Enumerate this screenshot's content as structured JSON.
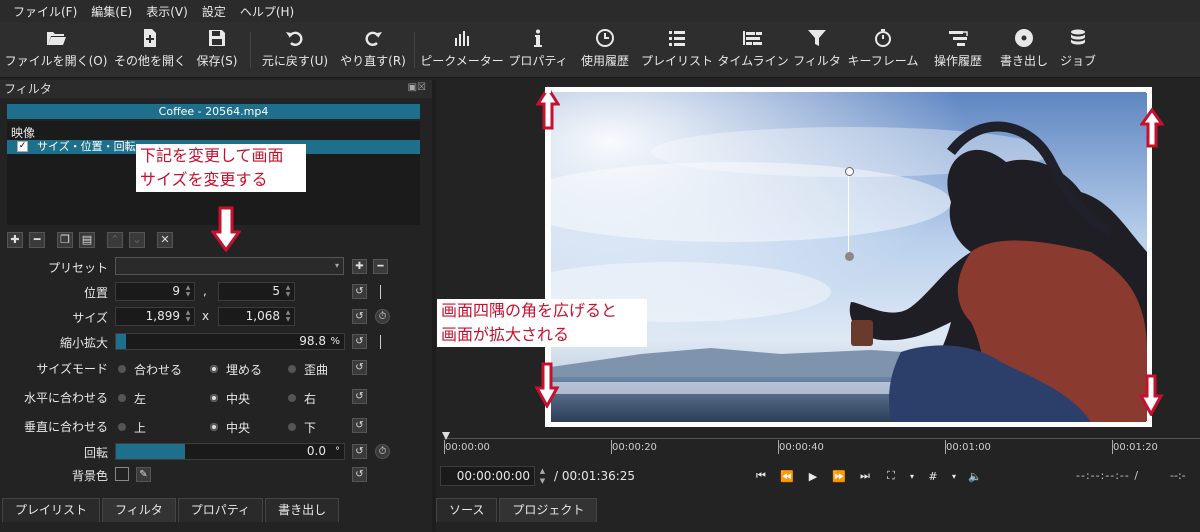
{
  "menu": [
    "ファイル(F)",
    "編集(E)",
    "表示(V)",
    "設定",
    "ヘルプ(H)"
  ],
  "toolbar": [
    {
      "label": "ファイルを開く(O)",
      "icon": "folder-open-icon"
    },
    {
      "label": "その他を開く",
      "icon": "file-plus-icon"
    },
    {
      "label": "保存(S)",
      "icon": "save-icon"
    },
    {
      "label": "元に戻す(U)",
      "icon": "undo-icon"
    },
    {
      "label": "やり直す(R)",
      "icon": "redo-icon"
    },
    {
      "label": "ピークメーター",
      "icon": "peak-meter-icon"
    },
    {
      "label": "プロパティ",
      "icon": "info-icon"
    },
    {
      "label": "使用履歴",
      "icon": "clock-icon"
    },
    {
      "label": "プレイリスト",
      "icon": "list-icon"
    },
    {
      "label": "タイムライン",
      "icon": "timeline-icon"
    },
    {
      "label": "フィルタ",
      "icon": "funnel-icon"
    },
    {
      "label": "キーフレーム",
      "icon": "stopwatch-icon"
    },
    {
      "label": "操作履歴",
      "icon": "history-icon"
    },
    {
      "label": "書き出し",
      "icon": "disc-icon"
    },
    {
      "label": "ジョブ",
      "icon": "database-icon"
    }
  ],
  "filter_panel": {
    "title": "フィルタ",
    "file_name": "Coffee - 20564.mp4",
    "section": "映像",
    "item": "サイズ・位置・回転",
    "callout": [
      "下記を変更して画面",
      "サイズを変更する"
    ],
    "preset_label": "プリセット",
    "position_label": "位置",
    "position_x": "9",
    "position_sep": ",",
    "position_y": "5",
    "size_label": "サイズ",
    "size_w": "1,899",
    "size_sep": "x",
    "size_h": "1,068",
    "zoom_label": "縮小拡大",
    "zoom_value": "98.8",
    "zoom_unit": "%",
    "zoom_fraction": 0.988,
    "size_mode_label": "サイズモード",
    "size_mode_options": [
      "合わせる",
      "埋める",
      "歪曲"
    ],
    "size_mode_selected": 1,
    "halign_label": "水平に合わせる",
    "halign_options": [
      "左",
      "中央",
      "右"
    ],
    "halign_selected": 1,
    "valign_label": "垂直に合わせる",
    "valign_options": [
      "上",
      "中央",
      "下"
    ],
    "valign_selected": 1,
    "rotation_label": "回転",
    "rotation_value": "0.0",
    "rotation_unit": "°",
    "bg_color_label": "背景色"
  },
  "bottom_tabs_left": [
    "プレイリスト",
    "フィルタ",
    "プロパティ",
    "書き出し"
  ],
  "viewer": {
    "callout": [
      "画面四隅の角を広げると",
      "画面が拡大される"
    ],
    "ruler": [
      "00:00:00",
      "00:00:20",
      "00:00:40",
      "00:01:00",
      "00:01:20"
    ],
    "timecode": "00:00:00:00",
    "duration": "/ 00:01:36:25",
    "right_timecode": "--:--:--:-- /",
    "right_timecode2": "--:-"
  },
  "bottom_tabs_right": [
    "ソース",
    "プロジェクト"
  ]
}
